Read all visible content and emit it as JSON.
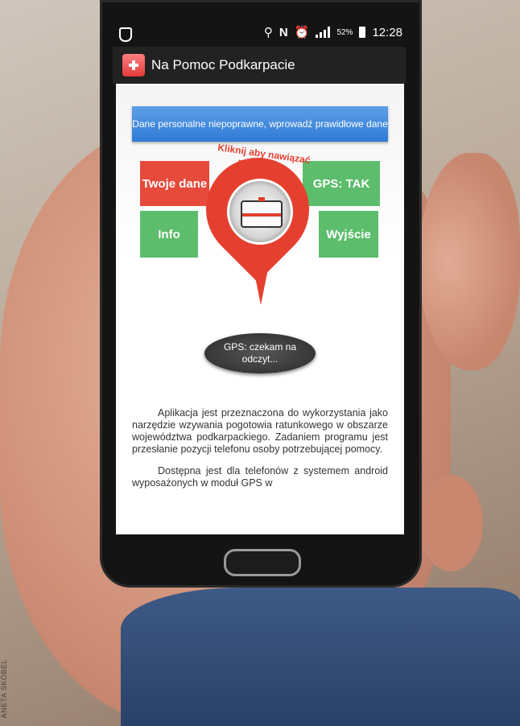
{
  "status_bar": {
    "icons": [
      "shield-icon",
      "location-icon",
      "n-icon",
      "alarm-icon",
      "signal-icon",
      "battery-icon"
    ],
    "battery_percent": "52%",
    "time": "12:28"
  },
  "app_bar": {
    "title": "Na Pomoc Podkarpacie",
    "icon": "medical-kit-icon",
    "accent": "#e33b3b"
  },
  "main": {
    "error_message": "Dane personalne niepoprawne, wprowadź prawidłowe dane",
    "tiles": {
      "twoje_dane": "Twoje dane",
      "info": "Info",
      "gps": "GPS: TAK",
      "wyjscie": "Wyjście"
    },
    "pin_label": "Kliknij aby nawiązać połączenie",
    "gps_status": "GPS: czekam na odczyt...",
    "description": [
      "Aplikacja jest przeznaczona do wykorzystania jako narzędzie wzywania pogotowia ratunkowego w obszarze województwa podkarpackiego. Zadaniem programu jest przesłanie pozycji telefonu osoby potrzebującej pomocy.",
      "Dostępna jest dla telefonów z systemem android wyposażonych w moduł GPS w"
    ]
  },
  "colors": {
    "red_tile": "#e54a3a",
    "green_tile": "#5cbd6c",
    "banner": "#2f7ad6"
  },
  "photo_credit": "ANETA SKÓBEL"
}
